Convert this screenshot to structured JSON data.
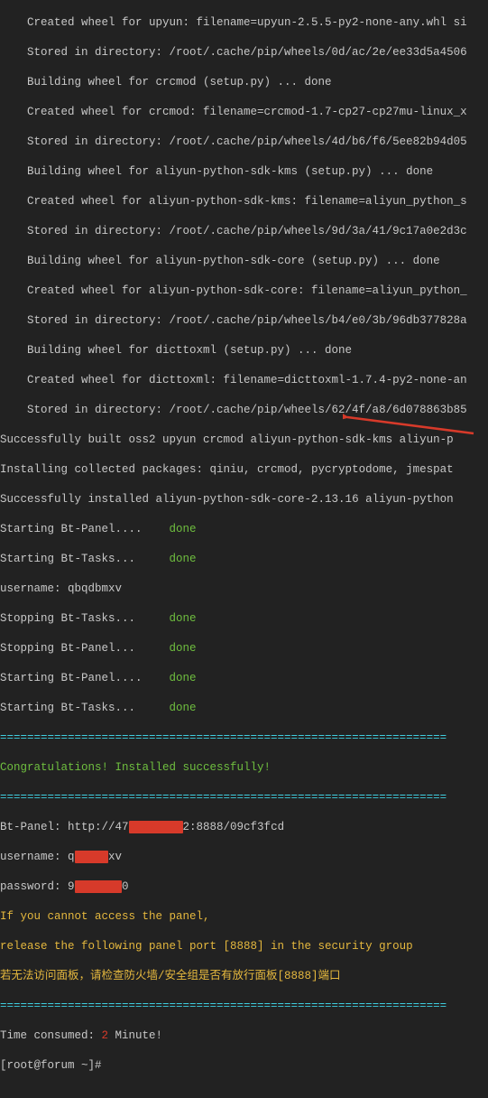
{
  "build": {
    "line0": "Created wheel for upyun: filename=upyun-2.5.5-py2-none-any.whl si",
    "stored0": "Stored in directory: /root/.cache/pip/wheels/0d/ac/2e/ee33d5a4506",
    "build_crcmod": "Building wheel for crcmod (setup.py) ... done",
    "created_crcmod": "Created wheel for crcmod: filename=crcmod-1.7-cp27-cp27mu-linux_x",
    "stored_crcmod": "Stored in directory: /root/.cache/pip/wheels/4d/b6/f6/5ee82b94d05",
    "build_kms": "Building wheel for aliyun-python-sdk-kms (setup.py) ... done",
    "created_kms": "Created wheel for aliyun-python-sdk-kms: filename=aliyun_python_s",
    "stored_kms": "Stored in directory: /root/.cache/pip/wheels/9d/3a/41/9c17a0e2d3c",
    "build_core": "Building wheel for aliyun-python-sdk-core (setup.py) ... done",
    "created_core": "Created wheel for aliyun-python-sdk-core: filename=aliyun_python_",
    "stored_core": "Stored in directory: /root/.cache/pip/wheels/b4/e0/3b/96db377828a",
    "build_dict": "Building wheel for dicttoxml (setup.py) ... done",
    "created_dict": "Created wheel for dicttoxml: filename=dicttoxml-1.7.4-py2-none-an",
    "stored_dict": "Stored in directory: /root/.cache/pip/wheels/62/4f/a8/6d078863b85",
    "success_built": "Successfully built oss2 upyun crcmod aliyun-python-sdk-kms aliyun-p",
    "installing": "Installing collected packages: qiniu, crcmod, pycryptodome, jmespat",
    "success_installed": "Successfully installed aliyun-python-sdk-core-2.13.16 aliyun-python"
  },
  "services": {
    "s1_label": "Starting Bt-Panel....",
    "s1_status": "done",
    "s2_label": "Starting Bt-Tasks...",
    "s2_status": "done",
    "usernameline": "username: qbqdbmxv",
    "s3_label": "Stopping Bt-Tasks...",
    "s3_status": "done",
    "s4_label": "Stopping Bt-Panel...",
    "s4_status": "done",
    "s5_label": "Starting Bt-Panel....",
    "s5_status": "done",
    "s6_label": "Starting Bt-Tasks...",
    "s6_status": "done"
  },
  "sep": "==================================================================",
  "congrats": "Congratulations! Installed successfully!",
  "panel": {
    "label": "Bt-Panel: ",
    "url_a": "http://47",
    "redact1": "x.xxx.xx",
    "url_b": "2:8888/09cf3fcd",
    "user_label": "username: q",
    "user_redact": "-----",
    "user_tail": "xv",
    "pass_label": "password: 9",
    "pass_redact": "-------",
    "pass_tail": "0"
  },
  "notice": {
    "en1": "If you cannot access the panel,",
    "en2": "release the following panel port [8888] in the security group",
    "zh": "若无法访问面板，请检查防火墙/安全组是否有放行面板[8888]端口"
  },
  "time": {
    "prefix": "Time consumed: ",
    "num": "2",
    "suffix": " Minute!"
  },
  "prompt": {
    "a": "[",
    "b": "root@forum",
    "c": " ~",
    "d": "]#"
  }
}
